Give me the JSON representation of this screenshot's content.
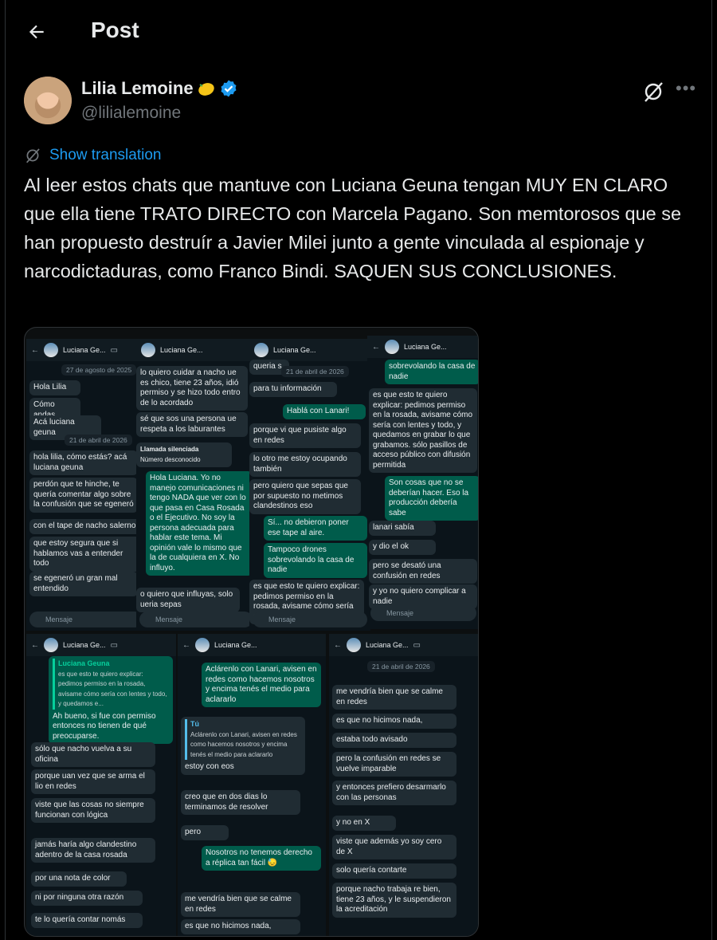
{
  "header": {
    "title": "Post"
  },
  "author": {
    "name": "Lilia Lemoine",
    "handle": "@lilialemoine"
  },
  "translate_label": "Show translation",
  "post_text": "Al leer estos chats que mantuve con Luciana Geuna tengan MUY EN CLARO que ella tiene TRATO DIRECTO con Marcela Pagano. Son memtorosos que se han propuesto destruír a Javier Milei junto a gente vinculada al espionaje y narcodictaduras, como Franco Bindi. SAQUEN SUS CONCLUSIONES.",
  "chat_screens": {
    "contact": "Luciana Ge...",
    "input_placeholder": "Mensaje",
    "s1": {
      "date1": "27 de agosto de 2025",
      "m1": "Hola Lilia",
      "m2": "Cómo andas",
      "m3": "Acá luciana geuna",
      "date2": "21 de abril de 2026",
      "m4": "hola lilia, cómo estás? acá luciana geuna",
      "m5": "perdón que te hinche, te quería comentar algo sobre la confusión que se egeneró",
      "m6": "con el tape de nacho salerno",
      "m7": "que estoy segura que si hablamos vas a entender todo",
      "m8": "se egeneró un gran mal entendido"
    },
    "s2": {
      "m1": "lo quiero cuidar a nacho ue es chico, tiene 23 años, idió permiso y se hizo todo entro de lo acordado",
      "m2": "sé que sos una persona ue respeta a los laburantes",
      "call": "Llamada silenciada",
      "call_sub": "Número desconocido",
      "m3": "Hola Luciana. Yo no manejo comunicaciones ni tengo NADA que ver con lo que pasa en Casa Rosada o el Ejecutivo. No soy la persona adecuada para hablar este tema. Mi opinión vale lo mismo que la de cualquiera en X. No influyo.",
      "m4": "o quiero que influyas, solo ueria sepas"
    },
    "s3": {
      "m0": "queria s",
      "date": "21 de abril de 2026",
      "m1": "para tu información",
      "m2": "Hablá con Lanari!",
      "m3": "porque vi que pusiste algo en redes",
      "m4": "lo otro me estoy ocupando también",
      "m5": "pero quiero que sepas que por supuesto no metimos clandestinos eso",
      "m6": "Sí... no debieron poner ese tape al aire.",
      "m7": "Tampoco drones sobrevolando la casa de nadie",
      "m8": "es que esto te quiero explicar: pedimos permiso en la rosada, avisame cómo sería con lentes y todo, y"
    },
    "s4": {
      "m0": "sobrevolando la casa de nadie",
      "m1": "es que esto te quiero explicar: pedimos permiso en la rosada, avisame cómo sería con lentes y todo, y quedamos en grabar lo que grabamos. sólo pasillos de acceso público con difusión permitida",
      "m2": "Son cosas que no se deberían hacer. Eso la producción debería sabe",
      "m3": "lanari sabía",
      "m4": "y dio el ok",
      "m5": "pero se desató una confusión en redes",
      "m6": "y yo no quiero complicar a nadie"
    },
    "s5": {
      "quote_name": "Luciana Geuna",
      "quote": "es que esto te quiero explicar: pedimos permiso en la rosada, avisame cómo sería con lentes y todo, y quedamos e...",
      "m1": "Ah bueno, si fue con permiso entonces no tienen de qué preocuparse.",
      "m2": "sólo que nacho vuelva a su oficina",
      "m3": "porque uan vez que se arma el lio en redes",
      "m4": "viste que las cosas no siempre funcionan con lógica",
      "m5": "jamás haría algo clandestino adentro de la casa rosada",
      "m6": "por una nota de color",
      "m7": "ni por ninguna otra razón",
      "m8": "te lo quería contar nomás"
    },
    "s6": {
      "m1": "Aclárenlo con Lanari, avisen en redes como hacemos nosotros y encima tenés el medio para aclararlo",
      "quote_name": "Tú",
      "quote": "Aclárenlo con Lanari, avisen en redes como hacemos nosotros y encima tenés el medio para aclararlo",
      "m2": "estoy con eos",
      "m3": "creo que en dos dias lo terminamos de resolver",
      "m4": "pero",
      "m5": "Nosotros no tenemos derecho a réplica tan fácil 😓",
      "m6": "me vendría bien que se calme en redes",
      "m7": "es que no hicimos nada,"
    },
    "s7": {
      "date": "21 de abril de 2026",
      "m1": "me vendría bien que se calme en redes",
      "m2": "es que no hicimos nada,",
      "m3": "estaba todo avisado",
      "m4": "pero la confusión en redes se vuelve imparable",
      "m5": "y entonces prefiero desarmarlo con las personas",
      "m6": "y no en X",
      "m7": "viste que además yo soy cero de X",
      "m8": "solo quería contarte",
      "m9": "porque nacho trabaja re bien, tiene 23 años, y le suspendieron la acreditación"
    }
  }
}
